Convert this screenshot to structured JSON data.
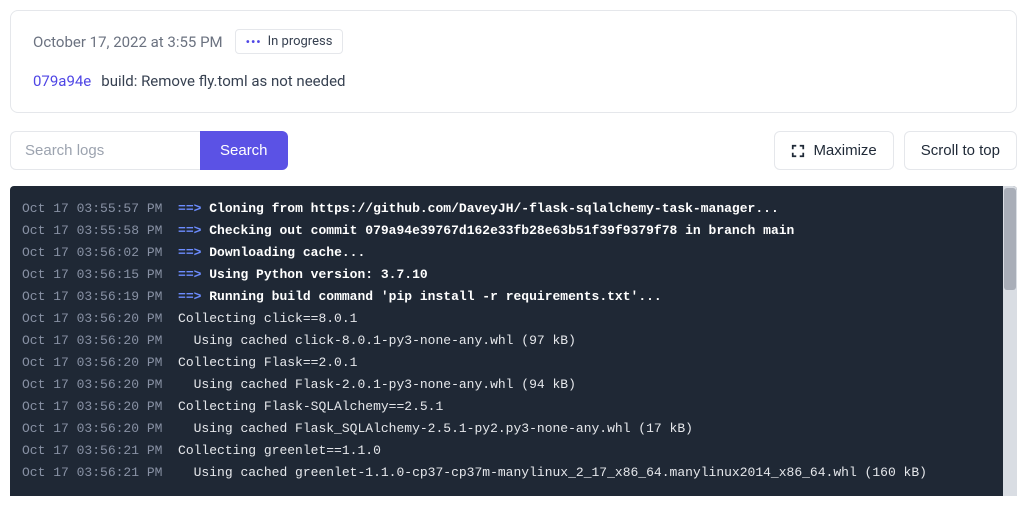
{
  "header": {
    "timestamp": "October 17, 2022 at 3:55 PM",
    "status_label": "In progress",
    "commit_hash": "079a94e",
    "commit_message": "build: Remove fly.toml as not needed"
  },
  "controls": {
    "search_placeholder": "Search logs",
    "search_button": "Search",
    "maximize": "Maximize",
    "scroll_top": "Scroll to top"
  },
  "logs": [
    {
      "ts": "Oct 17 03:55:57 PM",
      "arrow": true,
      "bold": true,
      "text": "Cloning from https://github.com/DaveyJH/-flask-sqlalchemy-task-manager..."
    },
    {
      "ts": "Oct 17 03:55:58 PM",
      "arrow": true,
      "bold": true,
      "text": "Checking out commit 079a94e39767d162e33fb28e63b51f39f9379f78 in branch main"
    },
    {
      "ts": "Oct 17 03:56:02 PM",
      "arrow": true,
      "bold": true,
      "text": "Downloading cache..."
    },
    {
      "ts": "Oct 17 03:56:15 PM",
      "arrow": true,
      "bold": true,
      "text": "Using Python version: 3.7.10"
    },
    {
      "ts": "Oct 17 03:56:19 PM",
      "arrow": true,
      "bold": true,
      "text": "Running build command 'pip install -r requirements.txt'..."
    },
    {
      "ts": "Oct 17 03:56:20 PM",
      "arrow": false,
      "bold": false,
      "text": "Collecting click==8.0.1"
    },
    {
      "ts": "Oct 17 03:56:20 PM",
      "arrow": false,
      "bold": false,
      "text": "  Using cached click-8.0.1-py3-none-any.whl (97 kB)"
    },
    {
      "ts": "Oct 17 03:56:20 PM",
      "arrow": false,
      "bold": false,
      "text": "Collecting Flask==2.0.1"
    },
    {
      "ts": "Oct 17 03:56:20 PM",
      "arrow": false,
      "bold": false,
      "text": "  Using cached Flask-2.0.1-py3-none-any.whl (94 kB)"
    },
    {
      "ts": "Oct 17 03:56:20 PM",
      "arrow": false,
      "bold": false,
      "text": "Collecting Flask-SQLAlchemy==2.5.1"
    },
    {
      "ts": "Oct 17 03:56:20 PM",
      "arrow": false,
      "bold": false,
      "text": "  Using cached Flask_SQLAlchemy-2.5.1-py2.py3-none-any.whl (17 kB)"
    },
    {
      "ts": "Oct 17 03:56:21 PM",
      "arrow": false,
      "bold": false,
      "text": "Collecting greenlet==1.1.0"
    },
    {
      "ts": "Oct 17 03:56:21 PM",
      "arrow": false,
      "bold": false,
      "text": "  Using cached greenlet-1.1.0-cp37-cp37m-manylinux_2_17_x86_64.manylinux2014_x86_64.whl (160 kB)"
    }
  ]
}
